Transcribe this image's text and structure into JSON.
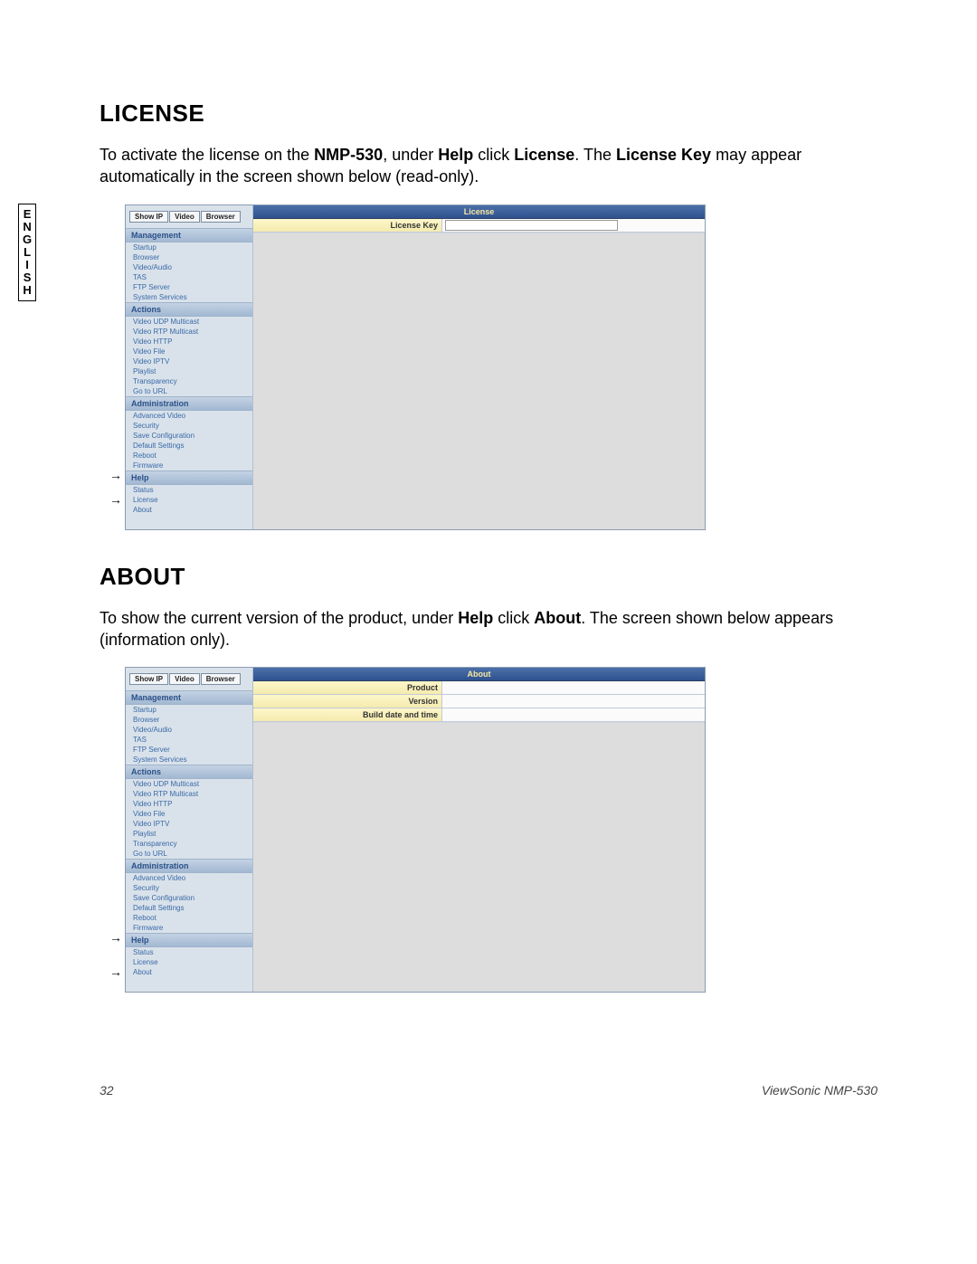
{
  "lang_tab": "ENGLISH",
  "section1": {
    "heading": "LICENSE",
    "para_parts": [
      "To activate the license on the ",
      "NMP-530",
      ", under ",
      "Help",
      " click ",
      "License",
      ". The ",
      "License Key",
      " may appear automatically in the screen shown below (read-only)."
    ]
  },
  "section2": {
    "heading": "ABOUT",
    "para_parts": [
      "To show the current version of the product, under ",
      "Help",
      " click ",
      "About",
      ". The screen shown below appears (information only)."
    ]
  },
  "screenshot_common": {
    "buttons": [
      "Show IP",
      "Video",
      "Browser"
    ],
    "groups": [
      {
        "header": "Management",
        "items": [
          "Startup",
          "Browser",
          "Video/Audio",
          "TAS",
          "FTP Server",
          "System Services"
        ]
      },
      {
        "header": "Actions",
        "items": [
          "Video UDP Multicast",
          "Video RTP Multicast",
          "Video HTTP",
          "Video File",
          "Video IPTV",
          "Playlist",
          "Transparency",
          "Go to URL"
        ]
      },
      {
        "header": "Administration",
        "items": [
          "Advanced Video",
          "Security",
          "Save Configuration",
          "Default Settings",
          "Reboot",
          "Firmware"
        ]
      },
      {
        "header": "Help",
        "items": [
          "Status",
          "License",
          "About"
        ]
      }
    ]
  },
  "screenshot1": {
    "title": "License",
    "fields": [
      {
        "label": "License Key",
        "style": "yellow",
        "input": true
      }
    ],
    "arrows": [
      "Help",
      "License"
    ]
  },
  "screenshot2": {
    "title": "About",
    "fields": [
      {
        "label": "Product",
        "style": "yellow"
      },
      {
        "label": "Version",
        "style": "yellow"
      },
      {
        "label": "Build date and time",
        "style": "yellow"
      }
    ],
    "arrows": [
      "Help",
      "About"
    ]
  },
  "footer": {
    "page": "32",
    "product": "ViewSonic NMP-530"
  }
}
